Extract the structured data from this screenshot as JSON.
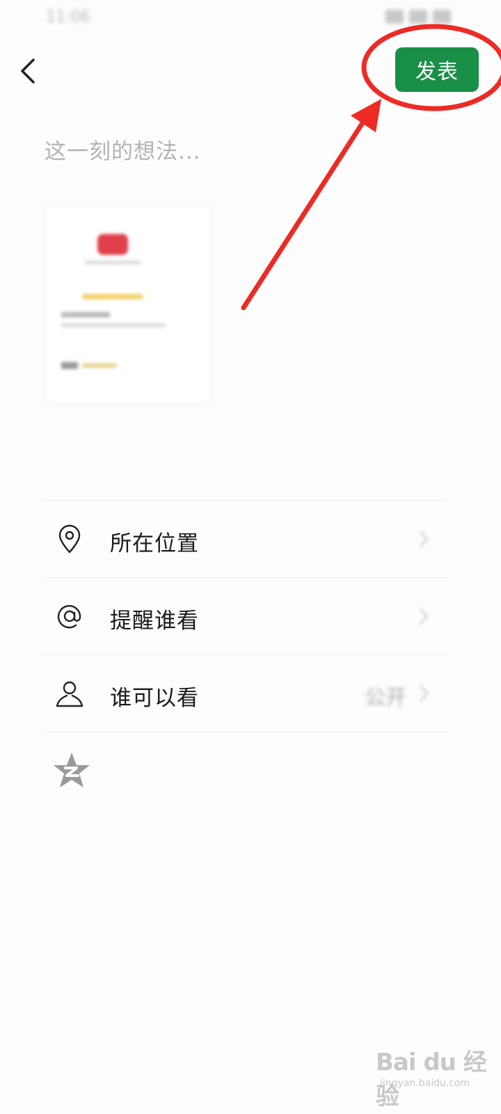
{
  "status_bar": {
    "time": "11:06"
  },
  "header": {
    "back_icon": "chevron-left-icon",
    "publish_label": "发表",
    "accent_color": "#1a8f47"
  },
  "composer": {
    "placeholder": "这一刻的想法..."
  },
  "menu": {
    "items": [
      {
        "icon": "location-pin-icon",
        "label": "所在位置",
        "value": ""
      },
      {
        "icon": "at-icon",
        "label": "提醒谁看",
        "value": ""
      },
      {
        "icon": "person-icon",
        "label": "谁可以看",
        "value": "公开"
      }
    ]
  },
  "share_targets": {
    "qzone_icon": "qzone-star-icon"
  },
  "watermark": {
    "main": "Bai du 经验",
    "sub": "jingyan.baidu.com"
  },
  "annotation": {
    "color": "#ee2a24"
  }
}
